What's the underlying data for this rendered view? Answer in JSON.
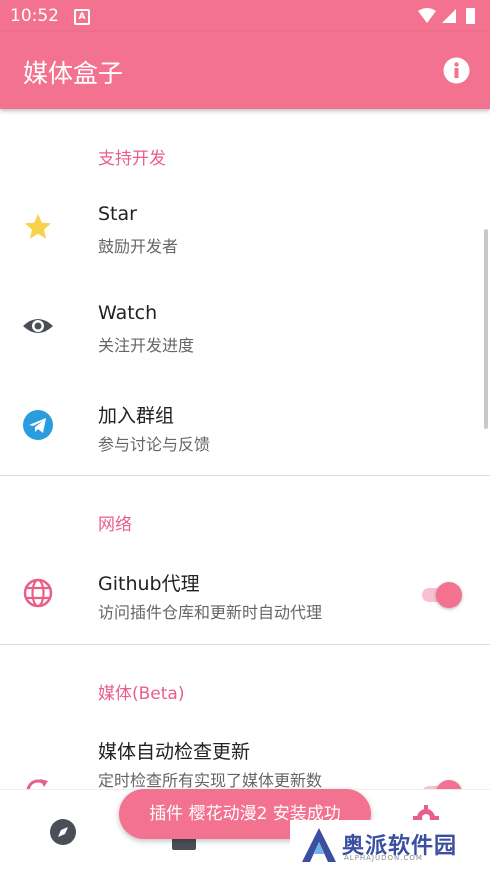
{
  "status_bar": {
    "time": "10:52",
    "notif_letter": "A"
  },
  "app_bar": {
    "title": "媒体盒子",
    "info_icon": "info-icon"
  },
  "sections": {
    "support": {
      "title": "支持开发",
      "items": [
        {
          "title": "Star",
          "subtitle": "鼓励开发者",
          "icon": "star-icon"
        },
        {
          "title": "Watch",
          "subtitle": "关注开发进度",
          "icon": "eye-icon"
        },
        {
          "title": "加入群组",
          "subtitle": "参与讨论与反馈",
          "icon": "telegram-icon"
        }
      ]
    },
    "network": {
      "title": "网络",
      "items": [
        {
          "title": "Github代理",
          "subtitle": "访问插件仓库和更新时自动代理",
          "icon": "globe-icon",
          "toggle_on": true
        }
      ]
    },
    "media": {
      "title": "媒体(Beta)",
      "items": [
        {
          "title": "媒体自动检查更新",
          "subtitle": "定时检查所有实现了媒体更新数",
          "icon": "refresh-icon",
          "toggle_on": true
        }
      ]
    }
  },
  "toast": {
    "message": "插件 樱花动漫2 安装成功"
  },
  "bottom_nav": [
    "compass-icon",
    "media-icon",
    "settings-icon"
  ],
  "watermark": {
    "text": "奥派软件园",
    "sub": "ALPHAJUDON.COM"
  },
  "colors": {
    "primary": "#f3728f",
    "accent_text": "#ea5f89",
    "star": "#f7d24a",
    "telegram": "#2a9de0"
  }
}
